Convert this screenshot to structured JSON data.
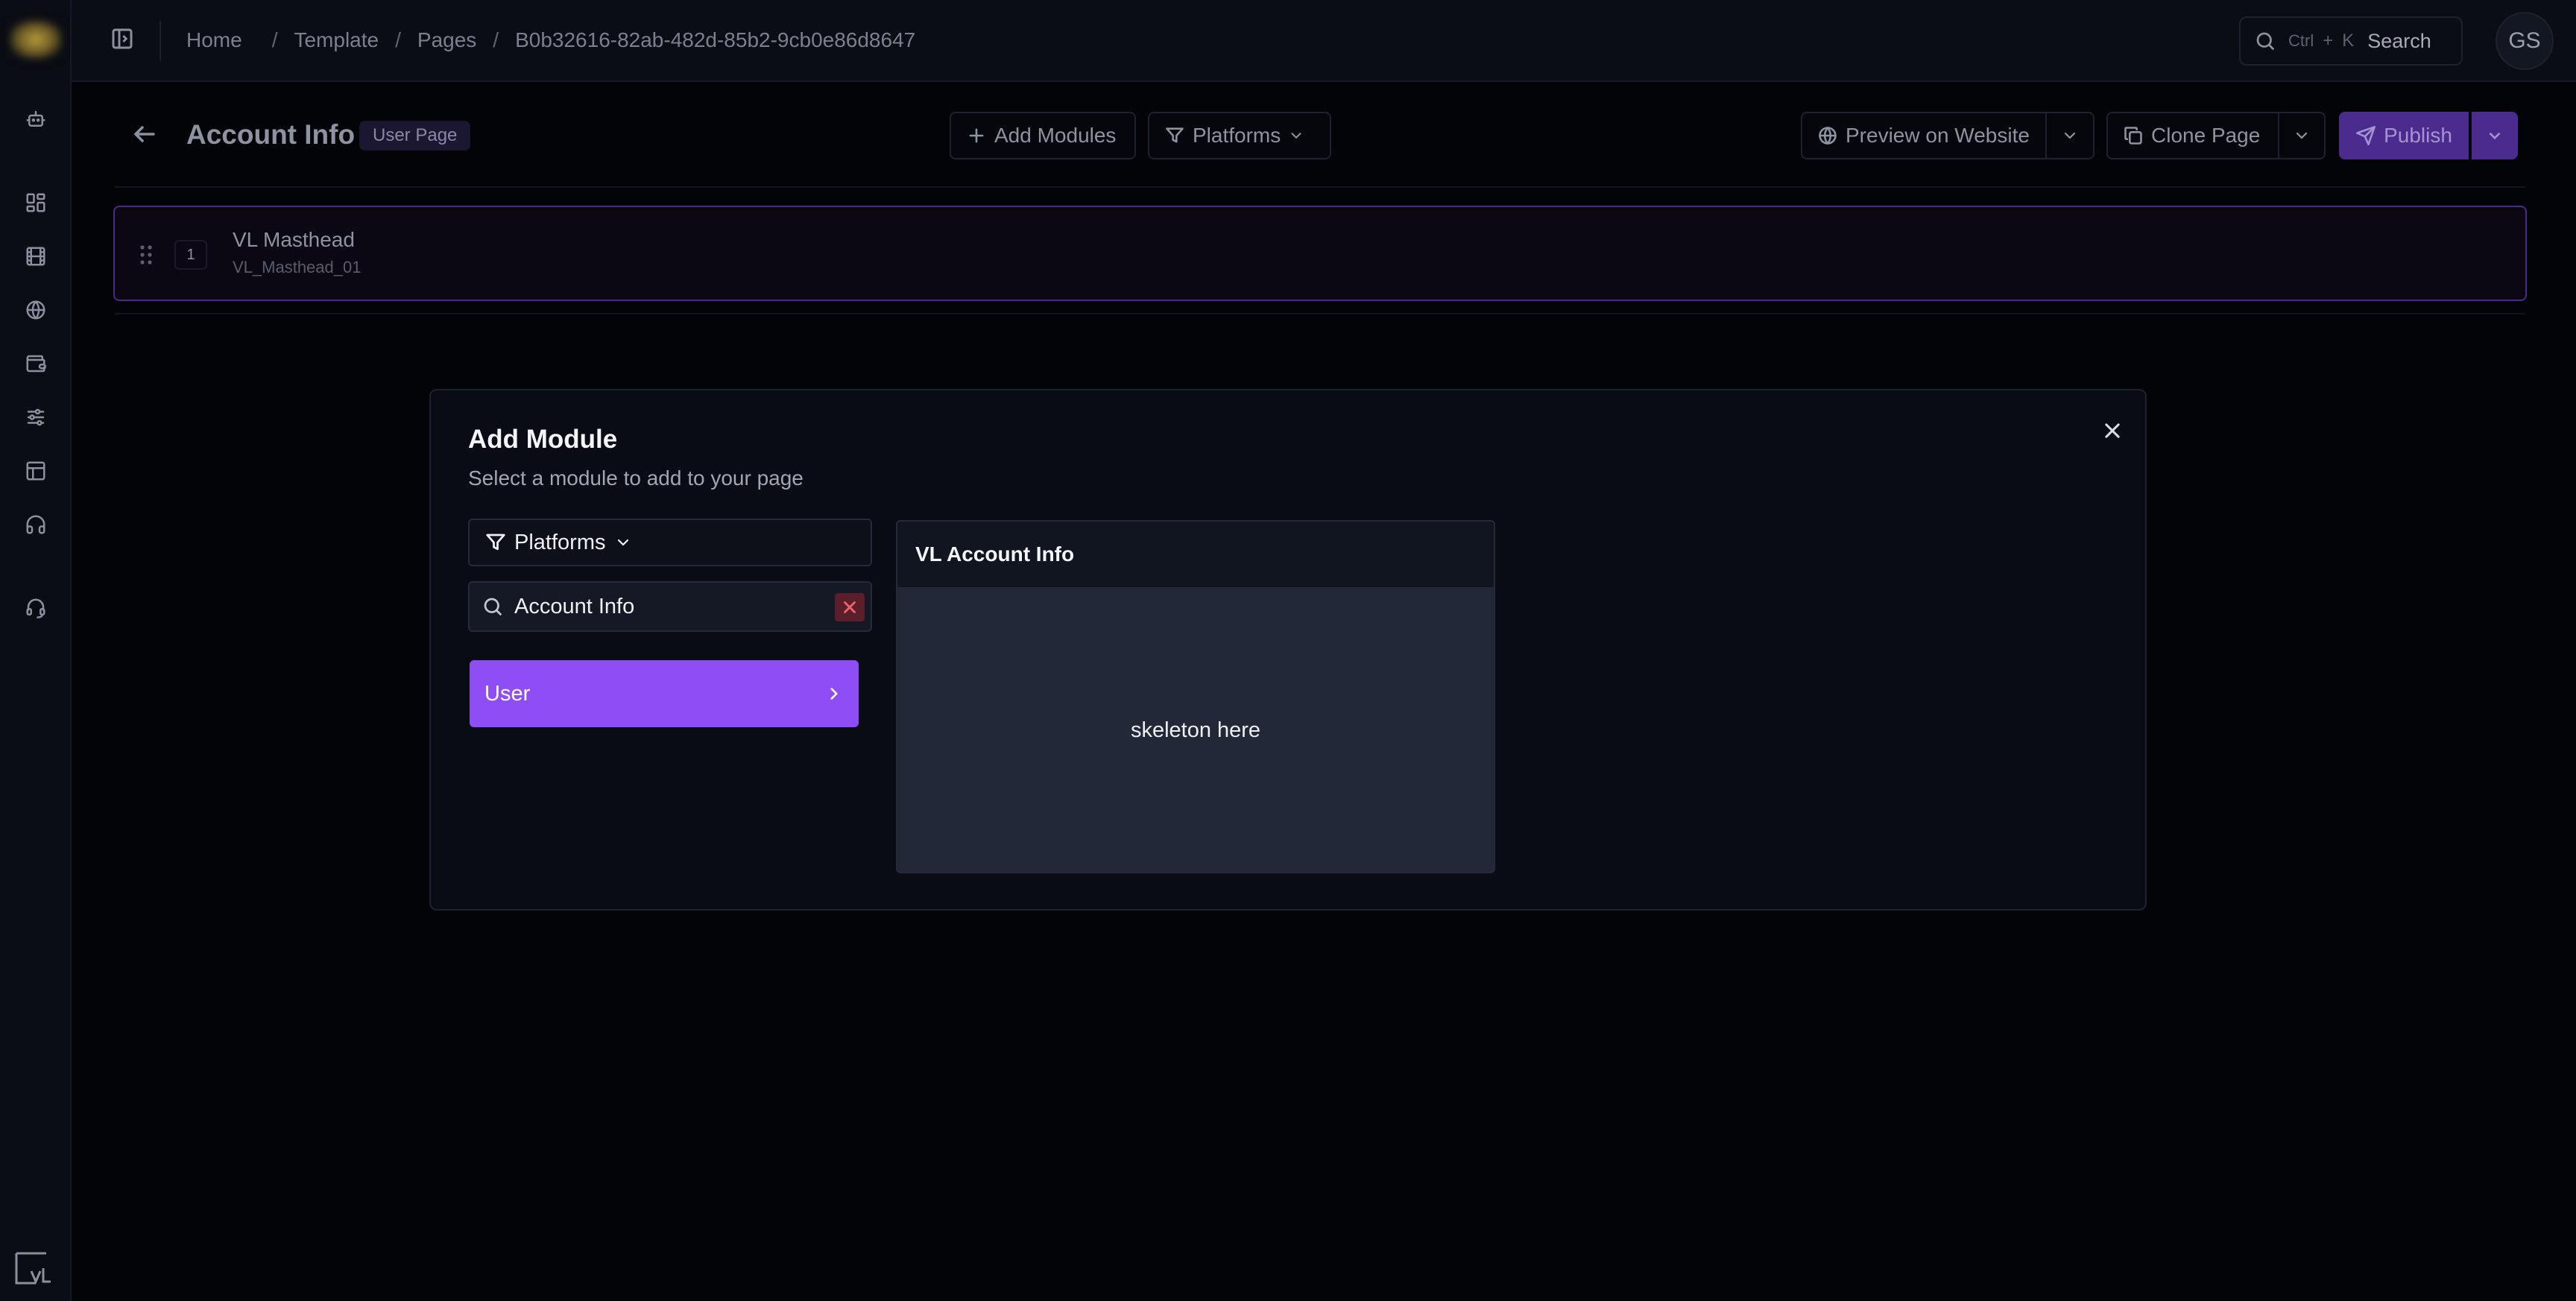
{
  "topbar": {
    "breadcrumbs": [
      "Home",
      "Template",
      "Pages",
      "B0b32616-82ab-482d-85b2-9cb0e86d8647"
    ],
    "search": {
      "shortcut_ctrl": "Ctrl",
      "shortcut_plus": "+",
      "shortcut_key": "K",
      "label": "Search"
    },
    "avatar_initials": "GS"
  },
  "sidebar": {
    "icons": [
      "bot-icon",
      "dashboard-icon",
      "film-icon",
      "globe-icon",
      "wallet-icon",
      "sliders-icon",
      "layout-icon",
      "headphones-icon",
      "support-icon"
    ]
  },
  "page_header": {
    "title": "Account Info",
    "badge": "User Page",
    "add_modules_label": "Add Modules",
    "platforms_label": "Platforms",
    "preview_label": "Preview on Website",
    "clone_label": "Clone Page",
    "publish_label": "Publish"
  },
  "modules": [
    {
      "index": "1",
      "title": "VL Masthead",
      "id": "VL_Masthead_01"
    }
  ],
  "modal": {
    "title": "Add Module",
    "subtitle": "Select a module to add to your page",
    "platforms_label": "Platforms",
    "search_value": "Account Info",
    "categories": [
      {
        "label": "User"
      }
    ],
    "preview": {
      "title": "VL Account Info",
      "body": "skeleton here"
    }
  },
  "colors": {
    "accent": "#8f4df5",
    "publish_bg": "#4c2b8f",
    "background": "#030408",
    "module_border": "#4b2a8a",
    "clear_bg": "#5a1f2a",
    "clear_icon": "#f1616f"
  }
}
